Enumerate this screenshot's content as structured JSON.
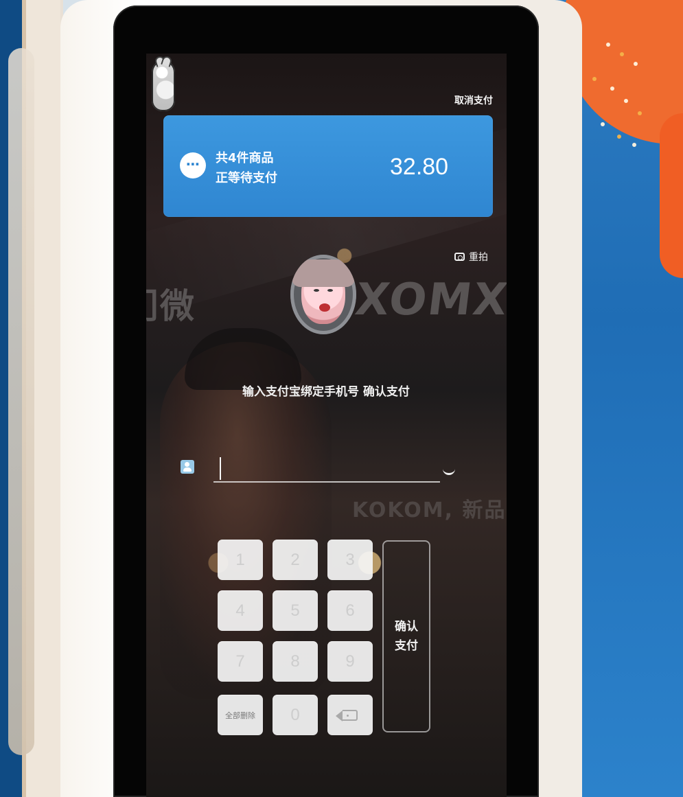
{
  "kiosk": {
    "cancel_payment": "取消支付",
    "order_summary_line_1": "共4件商品",
    "order_summary_line_2": "正等待支付",
    "amount": "32.80",
    "retake": "重拍",
    "instruction": "输入支付宝绑定手机号  确认支付",
    "phone_value": "",
    "phone_placeholder": "",
    "confirm_payment": "确认\n支付",
    "clear_all": "全部删除"
  },
  "keypad": {
    "keys": [
      "1",
      "2",
      "3",
      "4",
      "5",
      "6",
      "7",
      "8",
      "9",
      "0"
    ]
  },
  "background": {
    "left_sign_text": "门微",
    "right_sign_text": "XOMX",
    "lower_sign_text": "KOKOM, 新品"
  },
  "colors": {
    "payment_card": "#2f86d1",
    "keypad_key": "#f6f6f6",
    "screen": "#0f0f0f"
  },
  "icons": {
    "logo": "mascot-logo-icon",
    "order": "more-dots-icon",
    "retake": "camera-icon",
    "phone": "user-icon",
    "delete": "backspace-icon",
    "caret": "chevron-down-icon"
  }
}
